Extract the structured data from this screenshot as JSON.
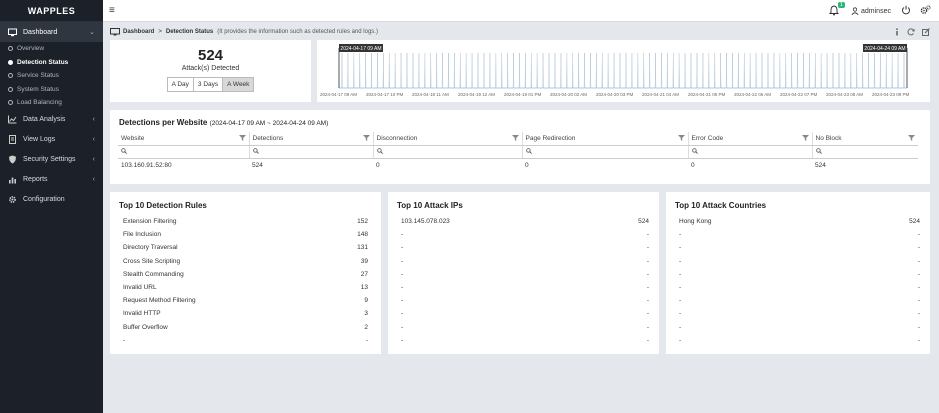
{
  "app": {
    "logo": "WAPPLES"
  },
  "sidebar": {
    "items": [
      {
        "label": "Dashboard",
        "icon": "monitor-icon",
        "active": true,
        "children": [
          {
            "label": "Overview"
          },
          {
            "label": "Detection Status",
            "active": true
          },
          {
            "label": "Service Status"
          },
          {
            "label": "System Status"
          },
          {
            "label": "Load Balancing"
          }
        ]
      },
      {
        "label": "Data Analysis",
        "icon": "chart-icon"
      },
      {
        "label": "View Logs",
        "icon": "document-icon"
      },
      {
        "label": "Security Settings",
        "icon": "shield-icon"
      },
      {
        "label": "Reports",
        "icon": "bar-chart-icon"
      },
      {
        "label": "Configuration",
        "icon": "gear-icon"
      }
    ]
  },
  "topbar": {
    "notification_count": "1",
    "username": "adminsec"
  },
  "breadcrumb": {
    "root": "Dashboard",
    "current": "Detection Status",
    "description": "(It provides the information such as detected rules and logs.)"
  },
  "summary": {
    "count": "524",
    "label": "Attack(s) Detected",
    "range_buttons": [
      "A Day",
      "3 Days",
      "A Week"
    ],
    "selected_range": "A Week"
  },
  "timeline": {
    "start_label": "2024-04-17 09 AM",
    "end_label": "2024-04-24 09 AM",
    "ticks": [
      "2024-04-17 09 AM",
      "2024-04-17 10 PM",
      "2024-04-18 11 AM",
      "2024-04-19 12 AM",
      "2024-04-19 01 PM",
      "2024-04-20 02 AM",
      "2024-04-20 03 PM",
      "2024-04-21 04 AM",
      "2024-04-21 05 PM",
      "2024-04-22 06 AM",
      "2024-04-22 07 PM",
      "2024-04-23 08 AM",
      "2024-04-23 09 PM"
    ],
    "series_color": "#5aa9e6"
  },
  "detections_per_website": {
    "title": "Detections per Website",
    "range": "(2024-04-17 09 AM ~ 2024-04-24 09 AM)",
    "columns": [
      "Website",
      "Detections",
      "Disconnection",
      "Page Redirection",
      "Error Code",
      "No Block"
    ],
    "rows": [
      [
        "103.160.91.52:80",
        "524",
        "0",
        "0",
        "0",
        "524"
      ]
    ]
  },
  "top_rules": {
    "title": "Top 10 Detection Rules",
    "items": [
      [
        "Extension Filtering",
        "152"
      ],
      [
        "File Inclusion",
        "148"
      ],
      [
        "Directory Traversal",
        "131"
      ],
      [
        "Cross Site Scripting",
        "39"
      ],
      [
        "Stealth Commanding",
        "27"
      ],
      [
        "Invalid URL",
        "13"
      ],
      [
        "Request Method Filtering",
        "9"
      ],
      [
        "Invalid HTTP",
        "3"
      ],
      [
        "Buffer Overflow",
        "2"
      ],
      [
        "-",
        "-"
      ]
    ]
  },
  "top_ips": {
    "title": "Top 10 Attack IPs",
    "items": [
      [
        "103.145.078.023",
        "524"
      ],
      [
        "-",
        "-"
      ],
      [
        "-",
        "-"
      ],
      [
        "-",
        "-"
      ],
      [
        "-",
        "-"
      ],
      [
        "-",
        "-"
      ],
      [
        "-",
        "-"
      ],
      [
        "-",
        "-"
      ],
      [
        "-",
        "-"
      ],
      [
        "-",
        "-"
      ]
    ]
  },
  "top_countries": {
    "title": "Top 10 Attack Countries",
    "items": [
      [
        "Hong Kong",
        "524"
      ],
      [
        "-",
        "-"
      ],
      [
        "-",
        "-"
      ],
      [
        "-",
        "-"
      ],
      [
        "-",
        "-"
      ],
      [
        "-",
        "-"
      ],
      [
        "-",
        "-"
      ],
      [
        "-",
        "-"
      ],
      [
        "-",
        "-"
      ],
      [
        "-",
        "-"
      ]
    ]
  }
}
